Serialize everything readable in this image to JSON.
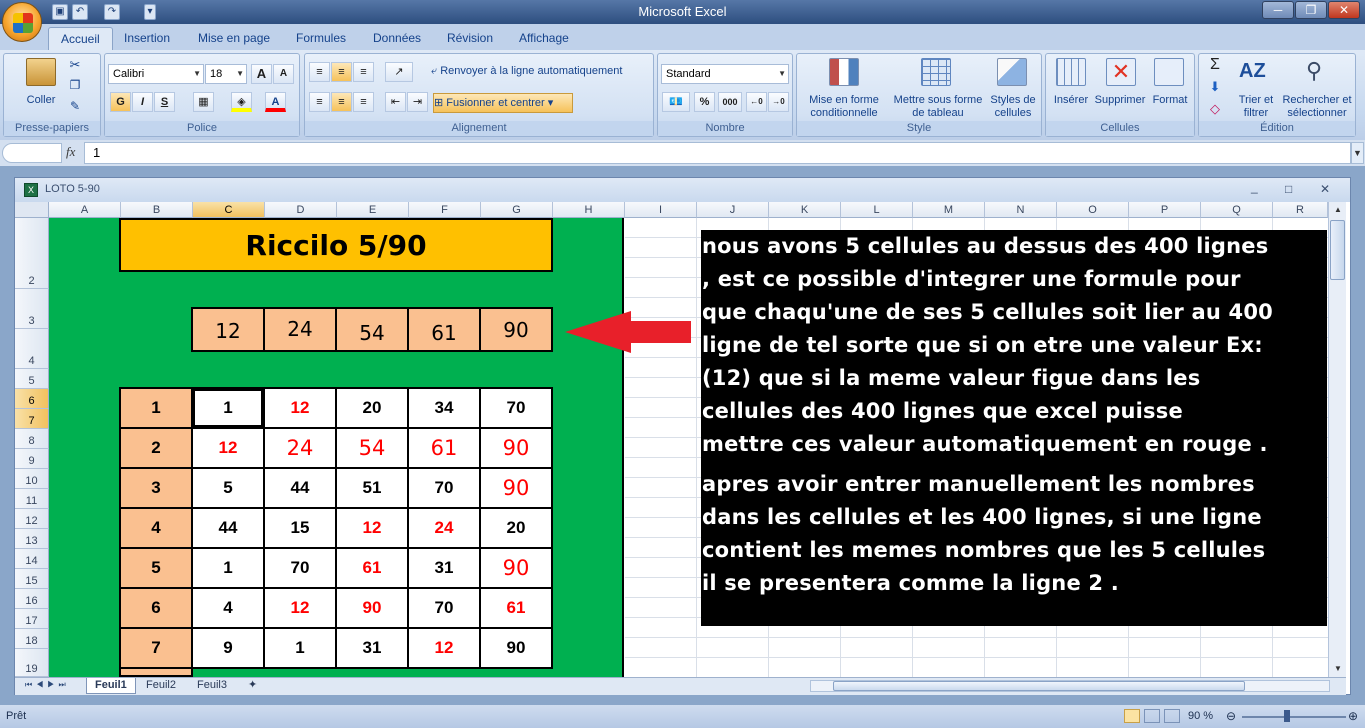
{
  "app": {
    "title": "Microsoft Excel",
    "window_min": "─",
    "window_max": "❐",
    "window_close": "✕"
  },
  "qat": {
    "save_icon": "floppy-icon",
    "undo": "↶",
    "redo": "↷",
    "customize": "▾"
  },
  "tabs": [
    "Accueil",
    "Insertion",
    "Mise en page",
    "Formules",
    "Données",
    "Révision",
    "Affichage"
  ],
  "ribbon": {
    "clipboard": {
      "paste_label": "Coller",
      "group_label": "Presse-papiers"
    },
    "font": {
      "name": "Calibri",
      "size": "18",
      "grow": "A",
      "shrink": "A",
      "bold": "G",
      "italic": "I",
      "underline": "S",
      "group_label": "Police"
    },
    "alignment": {
      "wrap_label": "Renvoyer à la ligne automatiquement",
      "merge_label": "Fusionner et centrer",
      "group_label": "Alignement"
    },
    "number": {
      "format": "Standard",
      "percent": "%",
      "thousands": "000",
      "group_label": "Nombre"
    },
    "style": {
      "conditional_label": "Mise en forme conditionnelle",
      "table_label": "Mettre sous forme de tableau",
      "cell_styles_label": "Styles de cellules",
      "group_label": "Style"
    },
    "cells": {
      "insert_label": "Insérer",
      "delete_label": "Supprimer",
      "format_label": "Format",
      "group_label": "Cellules"
    },
    "edit": {
      "sum": "Σ",
      "sort_label": "Trier et filtrer",
      "find_label": "Rechercher et sélectionner",
      "group_label": "Édition"
    }
  },
  "formula_bar": {
    "fx": "fx",
    "value": "1"
  },
  "workbook": {
    "title": "LOTO 5-90",
    "min": "_",
    "max": "□",
    "close": "✕"
  },
  "columns": [
    "A",
    "B",
    "C",
    "D",
    "E",
    "F",
    "G",
    "H",
    "I",
    "J",
    "K",
    "L",
    "M",
    "N",
    "O",
    "P",
    "Q",
    "R"
  ],
  "rows": [
    "2",
    "3",
    "4",
    "5",
    "6",
    "7",
    "8",
    "9",
    "10",
    "11",
    "12",
    "13",
    "14",
    "15",
    "16",
    "17",
    "18",
    "19"
  ],
  "sheet": {
    "title": "Riccilo 5/90",
    "numbers": [
      "12",
      "24",
      "54",
      "61",
      "90"
    ],
    "table": [
      {
        "idx": "1",
        "vals": [
          "1",
          "12",
          "20",
          "34",
          "70"
        ]
      },
      {
        "idx": "2",
        "vals": [
          "12",
          "24",
          "54",
          "61",
          "90"
        ]
      },
      {
        "idx": "3",
        "vals": [
          "5",
          "44",
          "51",
          "70",
          "90"
        ]
      },
      {
        "idx": "4",
        "vals": [
          "44",
          "15",
          "12",
          "24",
          "20"
        ]
      },
      {
        "idx": "5",
        "vals": [
          "1",
          "70",
          "61",
          "31",
          "90"
        ]
      },
      {
        "idx": "6",
        "vals": [
          "4",
          "12",
          "90",
          "70",
          "61"
        ]
      },
      {
        "idx": "7",
        "vals": [
          "9",
          "1",
          "31",
          "12",
          "90"
        ]
      }
    ],
    "text_lines": [
      "nous avons 5 cellules au dessus des 400 lignes",
      ", est ce possible d'integrer une formule pour",
      "que chaqu'une de ses 5 cellules soit lier au 400",
      "ligne de tel sorte que si on etre une valeur Ex:",
      "(12) que si la meme valeur figue dans les",
      "cellules des 400 lignes que excel puisse",
      "mettre ces valeur automatiquement en rouge .",
      " apres avoir entrer manuellement les nombres",
      "dans les cellules et les 400 lignes, si une ligne",
      "contient les memes nombres que les 5 cellules",
      "il se presentera comme la ligne 2 ."
    ]
  },
  "sheet_tabs": [
    "Feuil1",
    "Feuil2",
    "Feuil3"
  ],
  "status": {
    "ready": "Prêt",
    "zoom": "90 %"
  },
  "colors": {
    "green": "#00b050",
    "orange": "#ffc000",
    "peach": "#fac090",
    "red": "#ff0000",
    "arrow": "#e8202a"
  }
}
